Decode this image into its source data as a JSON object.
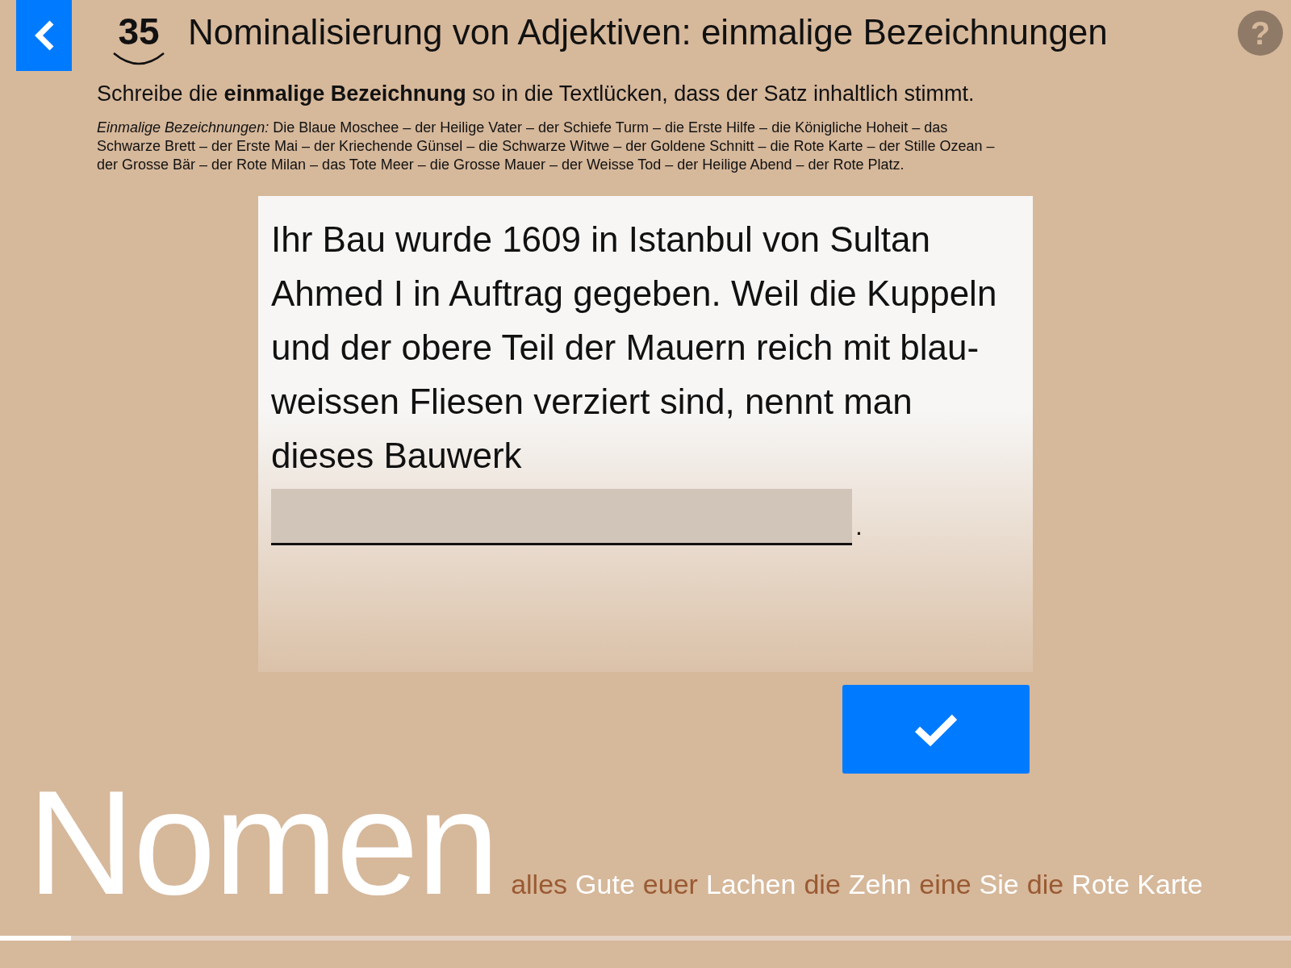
{
  "header": {
    "exercise_number": "35",
    "title": "Nominalisierung von Adjektiven: einmalige Bezeichnungen",
    "help_label": "?"
  },
  "instruction": "Schreibe die **einmalige Bezeichnung** so in die Textlücken, dass der Satz inhaltlich stimmt.",
  "word_list": "*Einmalige Bezeichnungen:* Die Blaue Moschee – der Heilige Vater – der Schiefe Turm – die Erste Hilfe – die Königliche Hoheit – das Schwarze Brett – der Erste Mai – der Kriechende Günsel – die Schwarze Witwe – der Goldene Schnitt – die Rote Karte – der Stille Ozean – der Grosse Bär – der Rote Milan – das Tote Meer – die Grosse Mauer – der Weisse Tod – der Heilige Abend – der Rote Platz.",
  "task": {
    "sentence": "Ihr Bau wurde 1609 in Istanbul von Sultan Ahmed I in Auftrag gegeben. Weil die Kuppeln und der obere Teil der Mauern reich mit blau-weissen Fliesen verziert sind, nennt man dieses Bauwerk",
    "after_gap": "."
  },
  "footer": {
    "topic": "Nomen",
    "words": [
      {
        "text": "alles",
        "color": "#9a5a32"
      },
      {
        "text": "Gute",
        "color": "#ffffff"
      },
      {
        "text": "euer",
        "color": "#9a5a32"
      },
      {
        "text": "Lachen",
        "color": "#ffffff"
      },
      {
        "text": "die",
        "color": "#9a5a32"
      },
      {
        "text": "Zehn",
        "color": "#ffffff"
      },
      {
        "text": "eine",
        "color": "#9a5a32"
      },
      {
        "text": "Sie",
        "color": "#ffffff"
      },
      {
        "text": "die",
        "color": "#9a5a32"
      },
      {
        "text": "Rote Karte",
        "color": "#ffffff"
      }
    ],
    "progress": {
      "level": 0.055
    }
  }
}
